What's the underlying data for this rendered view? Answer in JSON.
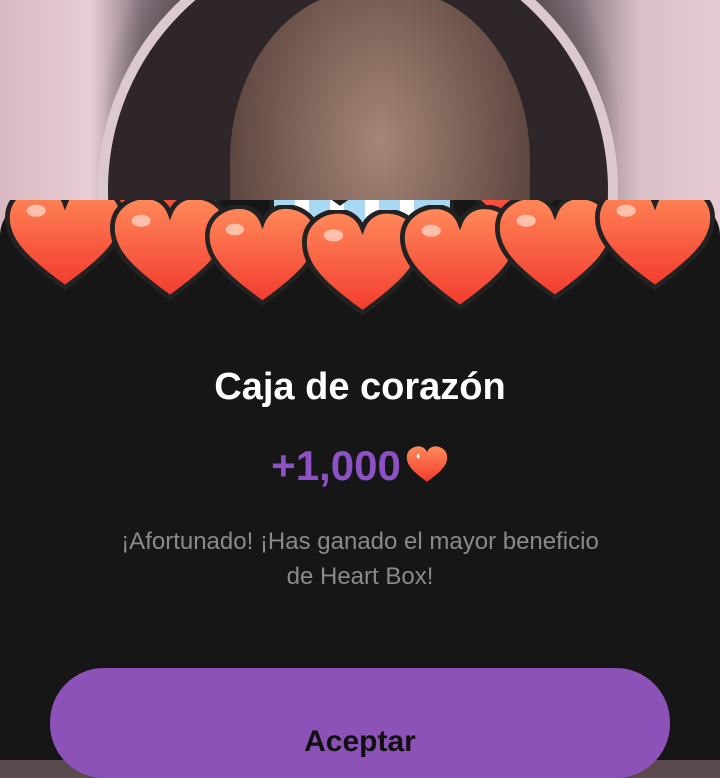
{
  "dialog": {
    "title": "Caja de corazón",
    "reward_amount": "+1,000",
    "reward_icon": "heart-icon",
    "message": "¡Afortunado! ¡Has ganado el mayor beneficio de Heart Box!",
    "accept_label": "Aceptar"
  },
  "colors": {
    "modal_background": "#161616",
    "reward_text": "#8c52c5",
    "accept_button": "#8d52b8",
    "heart": "#ff5a3c"
  }
}
